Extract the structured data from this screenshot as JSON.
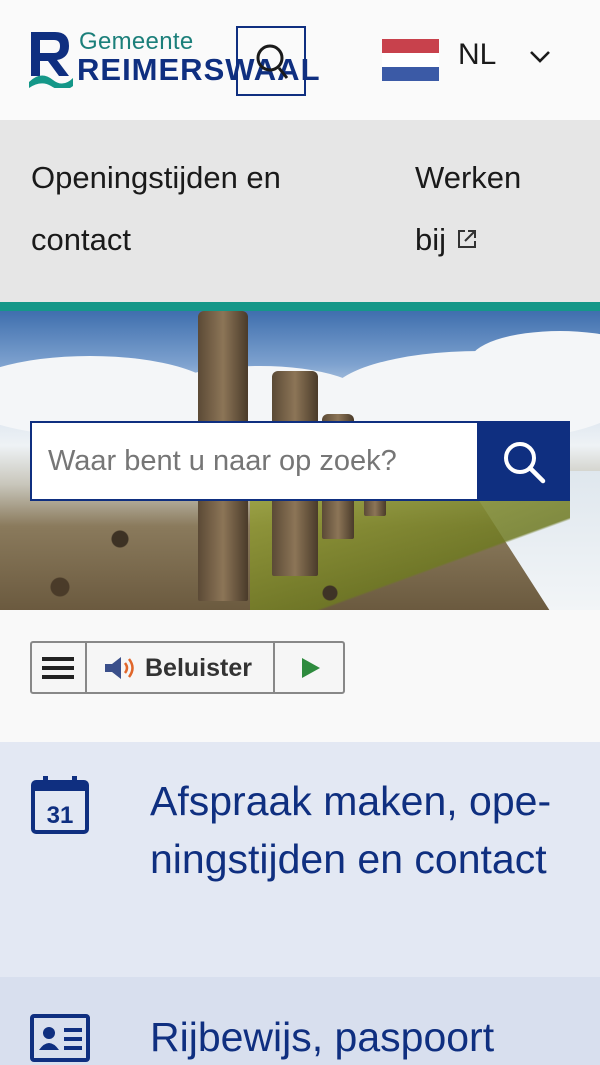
{
  "header": {
    "logo_top": "Gemeente",
    "logo_main": "REIMERSWAAL",
    "language": "NL"
  },
  "colors": {
    "brand_blue": "#0f2f80",
    "brand_teal": "#149788",
    "flag_red": "#c8414c",
    "flag_blue": "#3b5aa6"
  },
  "nav": {
    "items": [
      {
        "label": "Openingstijden en contact",
        "external": false
      },
      {
        "label": "Werken bij",
        "external": true
      }
    ]
  },
  "search": {
    "placeholder": "Waar bent u naar op zoek?"
  },
  "readspeaker": {
    "listen_label": "Beluister"
  },
  "cards": [
    {
      "title": "Afspraak maken, ope-ningstijden en contact",
      "icon": "calendar-icon",
      "icon_number": "31"
    },
    {
      "title": "Rijbewijs, paspoort",
      "icon": "id-card-icon"
    }
  ]
}
